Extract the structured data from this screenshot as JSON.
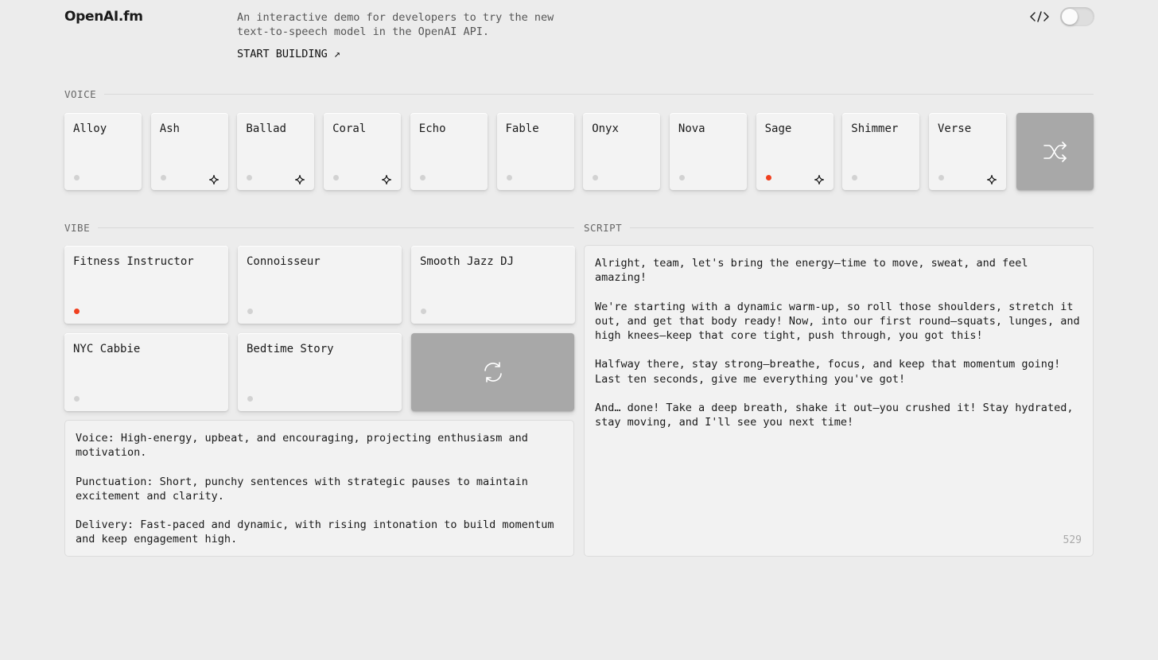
{
  "header": {
    "logo": "OpenAI.fm",
    "tagline": "An interactive demo for developers to try the new text-to-speech model in the OpenAI API.",
    "start_link": "START BUILDING ↗"
  },
  "voice": {
    "heading": "VOICE",
    "items": [
      {
        "label": "Alloy",
        "active": false,
        "spark": false
      },
      {
        "label": "Ash",
        "active": false,
        "spark": true
      },
      {
        "label": "Ballad",
        "active": false,
        "spark": true
      },
      {
        "label": "Coral",
        "active": false,
        "spark": true
      },
      {
        "label": "Echo",
        "active": false,
        "spark": false
      },
      {
        "label": "Fable",
        "active": false,
        "spark": false
      },
      {
        "label": "Onyx",
        "active": false,
        "spark": false
      },
      {
        "label": "Nova",
        "active": false,
        "spark": false
      },
      {
        "label": "Sage",
        "active": true,
        "spark": true
      },
      {
        "label": "Shimmer",
        "active": false,
        "spark": false
      },
      {
        "label": "Verse",
        "active": false,
        "spark": true
      }
    ],
    "shuffle_icon": "shuffle-icon"
  },
  "vibe": {
    "heading": "VIBE",
    "items": [
      {
        "label": "Fitness Instructor",
        "active": true
      },
      {
        "label": "Connoisseur",
        "active": false
      },
      {
        "label": "Smooth Jazz DJ",
        "active": false
      },
      {
        "label": "NYC Cabbie",
        "active": false
      },
      {
        "label": "Bedtime Story",
        "active": false
      }
    ],
    "refresh_icon": "refresh-icon",
    "description": "Voice: High-energy, upbeat, and encouraging, projecting enthusiasm and motivation.\n\nPunctuation: Short, punchy sentences with strategic pauses to maintain excitement and clarity.\n\nDelivery: Fast-paced and dynamic, with rising intonation to build momentum and keep engagement high."
  },
  "script": {
    "heading": "SCRIPT",
    "text": "Alright, team, let's bring the energy—time to move, sweat, and feel amazing!\n\nWe're starting with a dynamic warm-up, so roll those shoulders, stretch it out, and get that body ready! Now, into our first round—squats, lunges, and high knees—keep that core tight, push through, you got this!\n\nHalfway there, stay strong—breathe, focus, and keep that momentum going! Last ten seconds, give me everything you've got!\n\nAnd… done! Take a deep breath, shake it out—you crushed it! Stay hydrated, stay moving, and I'll see you next time!",
    "char_count": "529"
  },
  "colors": {
    "accent": "#f0401f",
    "background": "#ececec",
    "card": "#f3f3f3",
    "action_tile": "#a8a8a8"
  }
}
